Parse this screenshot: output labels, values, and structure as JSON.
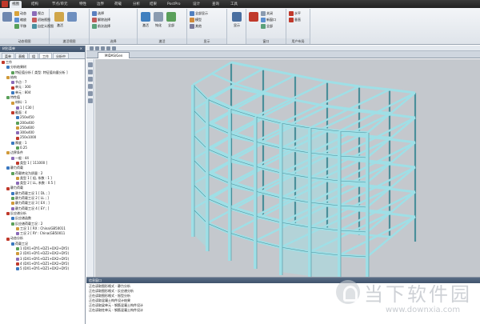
{
  "menubar": {
    "tabs": [
      {
        "label": "视图",
        "active": true
      },
      {
        "label": "结构"
      },
      {
        "label": "节点/单元"
      },
      {
        "label": "特性"
      },
      {
        "label": "边界"
      },
      {
        "label": "荷载"
      },
      {
        "label": "分析"
      },
      {
        "label": "结果"
      },
      {
        "label": "PostPro"
      },
      {
        "label": "设计"
      },
      {
        "label": "查询"
      },
      {
        "label": "工具"
      }
    ]
  },
  "ribbon": {
    "groups": [
      {
        "label": "动态视图",
        "buttons": [
          "动态",
          "视点",
          "缩放",
          "平移",
          "初始视图",
          "自定义视图"
        ]
      },
      {
        "label": "激活视图",
        "buttons": [
          "激活"
        ]
      },
      {
        "label": "选择",
        "buttons": [
          "选择",
          "解除选择",
          "前次选择"
        ]
      },
      {
        "label": "激活",
        "buttons": [
          "激活",
          "钝化",
          "全部"
        ]
      },
      {
        "label": "显示",
        "buttons": [
          "全部显示",
          "模型",
          "其他"
        ]
      },
      {
        "label": "",
        "buttons": [
          "显示"
        ]
      },
      {
        "label": "窗口",
        "buttons": [
          "关闭",
          "新窗口",
          "全部"
        ]
      },
      {
        "label": "用户布局",
        "buttons": [
          "水平",
          "垂直"
        ]
      }
    ]
  },
  "left_panel": {
    "title": "树形菜单",
    "close": "×",
    "tabs": [
      "菜单",
      "表格",
      "组",
      "工作",
      "分析中"
    ],
    "active_tab": "工作",
    "tree": [
      "工作",
      "分析结果树",
      "特征值分析 [ 类型: 特征值向量分析 ]",
      "结构",
      "节点 : 7",
      "单元 : 300",
      "单元 : 804",
      "特性值",
      "材料 : 1",
      "1 [ C30 ]",
      "截面 : 4",
      "250x450",
      "200x400",
      "250x600",
      "300x400",
      "250x1000",
      "厚度 : 1",
      "0.25",
      "边界条件",
      "一般 : 44",
      "类型 1 [ 111000 ]",
      "静力荷载",
      "荷载转化为质量 : 2",
      "类型 1 [ 组, 系数 : 1 ]",
      "类型 2 [ LL, 系数 : 0.5 ]",
      "静力荷载",
      "静力荷载工况 1 [ DL ; ]",
      "静力荷载工况 2 [ LL ; ]",
      "静力荷载工况 3 [ EX ; ]",
      "静力荷载工况 4 [ EY ; ]",
      "反应谱分析",
      "反应谱函数",
      "反应谱荷载工况 : 2",
      "工况 1 [ RX : China(GB50011",
      "工况 2 [ RY : China(GB50011",
      "动态分析",
      "荷载工况",
      "1 (DX1+DY1+DZ1+DX2+DY2)",
      "2 (DX1+DY1+DZ2+DX2+DY2)",
      "3 (DX1+DY1+DZ1+DX2+DY2)",
      "4 (DX1+DY1+DZ1+DX2+DY2)",
      "5 (DX1+DY1+DZ1+DX2+DY2)"
    ]
  },
  "viewport": {
    "tab_label": "MIDAS/Gen"
  },
  "message_window": {
    "title": "信息窗口",
    "lines": [
      "正在读取图形格式 - 静力分析",
      "正在读取图形格式 - 反应谱分析",
      "正在读取图形格式 - 振型分析",
      "正在读取混凝土构件设计结果",
      "正在读取梁单元 - 钢筋混凝土构件设计",
      "正在读取柱单元 - 钢筋混凝土构件设计"
    ]
  },
  "watermark": {
    "cn": "当下软件园",
    "url": "www.downxia.com"
  },
  "colors": {
    "model_fill": "#9fdfe6",
    "model_stroke": "#4a8f9a",
    "viewport_bg": "#c4c8cd",
    "accent": "#c0392b"
  }
}
